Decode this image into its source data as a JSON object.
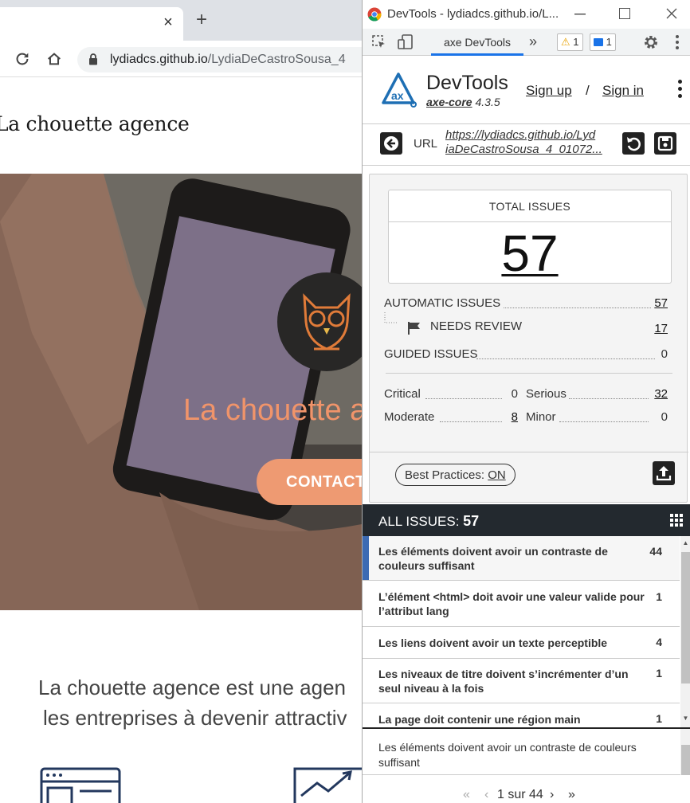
{
  "browser": {
    "tab_close": "×",
    "new_tab": "+",
    "url_host": "lydiadcs.github.io",
    "url_path": "/LydiaDeCastroSousa_4"
  },
  "site": {
    "logo": "La chouette agence",
    "hero_title": "La chouette a",
    "contact_button": "CONTACT",
    "intro_line1": "La chouette agence est une agen",
    "intro_line2": "les entreprises à devenir attractiv",
    "accent_color": "#ee9a72"
  },
  "devtools": {
    "window_title": "DevTools - lydiadcs.github.io/L...",
    "active_tab": "axe DevTools",
    "more_tabs": "»",
    "warnings_count": "1",
    "messages_count": "1"
  },
  "axe": {
    "brand": "DevTools",
    "core_name": "axe-core",
    "core_version": "4.3.5",
    "sign_up": "Sign up",
    "separator": "/",
    "sign_in": "Sign in",
    "url_label": "URL",
    "url_line1": "https://lydiadcs.github.io/Lyd",
    "url_line2": "iaDeCastroSousa_4_01072...",
    "total_label": "TOTAL ISSUES",
    "total_count": "57",
    "automatic_label": "AUTOMATIC ISSUES",
    "automatic_count": "57",
    "review_label": "NEEDS REVIEW",
    "review_count": "17",
    "guided_label": "GUIDED ISSUES",
    "guided_count": "0",
    "critical_label": "Critical",
    "critical_count": "0",
    "serious_label": "Serious",
    "serious_count": "32",
    "moderate_label": "Moderate",
    "moderate_count": "8",
    "minor_label": "Minor",
    "minor_count": "0",
    "best_practices_label": "Best Practices:",
    "best_practices_value": "ON",
    "all_issues_label": "ALL ISSUES:",
    "all_issues_count": "57",
    "issues": [
      {
        "text": "Les éléments doivent avoir un contraste de couleurs suffisant",
        "count": "44"
      },
      {
        "text": "L’élément <html> doit avoir une valeur valide pour l’attribut lang",
        "count": "1"
      },
      {
        "text": "Les liens doivent avoir un texte perceptible",
        "count": "4"
      },
      {
        "text": "Les niveaux de titre doivent s’incrémenter d’un seul niveau à la fois",
        "count": "1"
      },
      {
        "text": "La page doit contenir une région main",
        "count": "1"
      }
    ],
    "detail_text": "Les éléments doivent avoir un contraste de couleurs suffisant",
    "pager_first": "«",
    "pager_prev": "‹",
    "pager_text": "1 sur 44",
    "pager_next": "›",
    "pager_last": "»",
    "selected_color": "#3d6bb3"
  }
}
